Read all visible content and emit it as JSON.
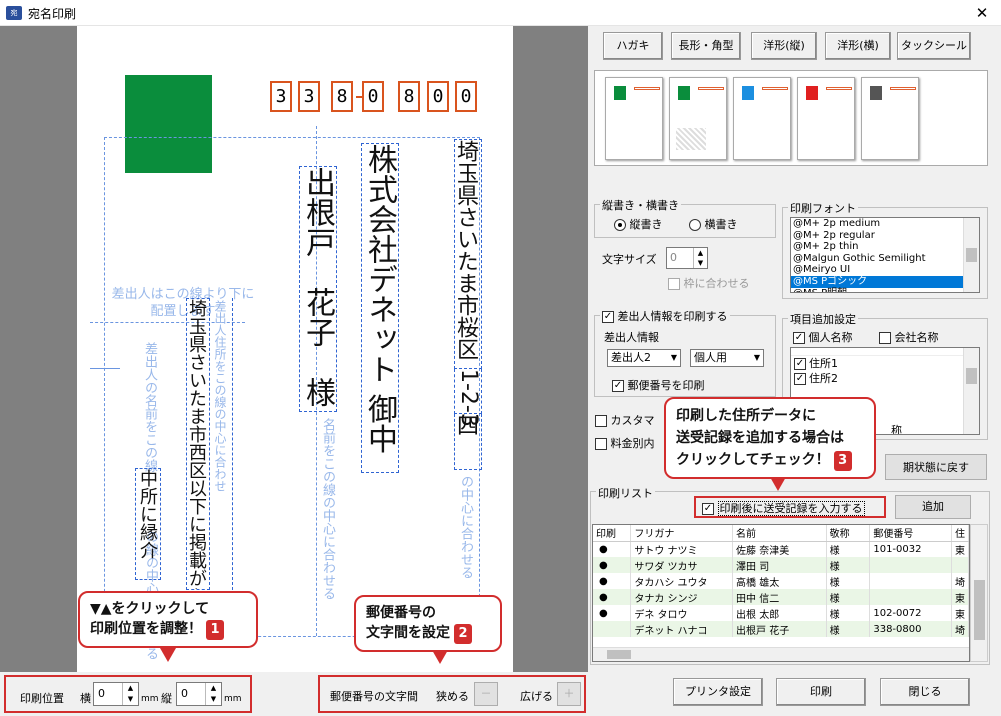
{
  "window": {
    "title": "宛名印刷",
    "icon_text": "宛"
  },
  "preview": {
    "zip_digits": [
      "3",
      "3",
      "8",
      "0",
      "8",
      "0",
      "0"
    ],
    "recipient_company": "株式会社デネット 御中",
    "recipient_name": "出根戸　花子　様",
    "recipient_address": "埼玉県さいたま市桜区",
    "recipient_address_num": "1‐2‐3",
    "recipient_address_end": "四",
    "sender_guide_h": "差出人はこの線より下に配置します",
    "sender_guide_v": "差出人の名前をこの線",
    "sender_guide_v2": "の線の中心に合わせる",
    "center_guide_1": "名前をこの線の中心に合わせる",
    "center_guide_2": "の中心に合わせる",
    "sender_addr_text": "埼玉県さいたま市西区以下に掲載がない場",
    "sender_addr_guide": "差出人住所をこの線の中心に合わせ",
    "sender_name_text": "中所に縁介"
  },
  "callouts": {
    "c1_line1": "▼▲をクリックして",
    "c1_line2": "印刷位置を調整！",
    "c1_num": "1",
    "c2_line1": "郵便番号の",
    "c2_line2": "文字間を設定",
    "c2_num": "2",
    "c3_line1": "印刷した住所データに",
    "c3_line2": "送受記録を追加する場合は",
    "c3_line3": "クリックしてチェック！",
    "c3_num": "3"
  },
  "toolbar": {
    "buttons": [
      "ハガキ",
      "長形・角型",
      "洋形(縦)",
      "洋形(横)",
      "タックシール"
    ]
  },
  "orientation": {
    "label": "縦書き・横書き",
    "vertical": "縦書き",
    "horizontal": "横書き"
  },
  "font_size": {
    "label": "文字サイズ",
    "value": "0",
    "fit_label": "枠に合わせる"
  },
  "print_font": {
    "label": "印刷フォント",
    "items": [
      "@M+ 2p medium",
      "@M+ 2p regular",
      "@M+ 2p thin",
      "@Malgun Gothic Semilight",
      "@Meiryo UI",
      "@MS Pゴシック",
      "@MS P明朝"
    ],
    "selected": "@MS Pゴシック"
  },
  "sender": {
    "print_label": "差出人情報を印刷する",
    "info_label": "差出人情報",
    "select1": "差出人2",
    "select2": "個人用",
    "zip_print": "郵便番号を印刷"
  },
  "items_add": {
    "label": "項目追加設定",
    "personal": "個人名称",
    "company": "会社名称",
    "list": [
      "住所1",
      "住所2"
    ],
    "partial_top": "",
    "partial_bottom": "称"
  },
  "misc": {
    "custom_label": "カスタマ",
    "fee_label": "料金別内",
    "reset_button": "期状態に戻す"
  },
  "print_list": {
    "label": "印刷リスト",
    "record_check": "印刷後に送受記録を入力する",
    "add_button": "追加",
    "columns": [
      "印刷",
      "フリガナ",
      "名前",
      "敬称",
      "郵便番号",
      "住"
    ],
    "rows": [
      {
        "mark": "●",
        "kana": "サトウ ナツミ",
        "name": "佐藤 奈津美",
        "title": "様",
        "zip": "101-0032",
        "addr": "東"
      },
      {
        "mark": "●",
        "kana": "サワダ ツカサ",
        "name": "澤田 司",
        "title": "様",
        "zip": "",
        "addr": ""
      },
      {
        "mark": "●",
        "kana": "タカハシ ユウタ",
        "name": "高橋 雄太",
        "title": "様",
        "zip": "",
        "addr": "埼"
      },
      {
        "mark": "●",
        "kana": "タナカ シンジ",
        "name": "田中 信二",
        "title": "様",
        "zip": "",
        "addr": "東"
      },
      {
        "mark": "●",
        "kana": "デネ タロウ",
        "name": "出根 太郎",
        "title": "様",
        "zip": "102-0072",
        "addr": "東"
      },
      {
        "mark": "",
        "kana": "デネット ハナコ",
        "name": "出根戸 花子",
        "title": "様",
        "zip": "338-0800",
        "addr": "埼"
      }
    ]
  },
  "bottom": {
    "position_label": "印刷位置",
    "horizontal_label": "横",
    "vertical_label": "縦",
    "h_value": "0",
    "v_value": "0",
    "unit": "mm",
    "zip_spacing_label": "郵便番号の文字間",
    "narrow_label": "狭める",
    "narrow_btn": "－",
    "widen_label": "広げる",
    "widen_btn": "＋",
    "printer_button": "プリンタ設定",
    "print_button": "印刷",
    "close_button": "閉じる"
  },
  "colors": {
    "stamp": "#0a8d3c",
    "zip_border": "#d9541e",
    "callout": "#d22d2d",
    "selection": "#0078d7"
  }
}
